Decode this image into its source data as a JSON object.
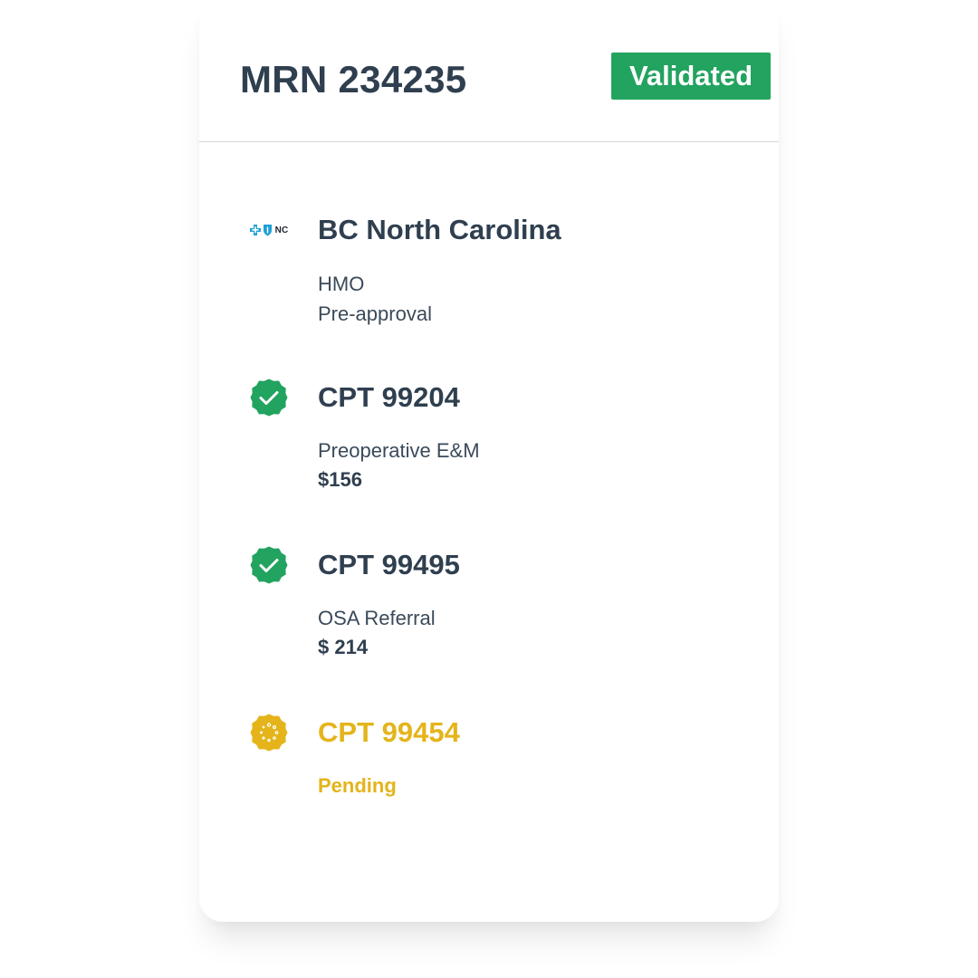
{
  "header": {
    "title": "MRN 234235",
    "status": "Validated"
  },
  "colors": {
    "validated": "#22a35f",
    "pending": "#e4b41a",
    "text": "#2f3f4f",
    "insurer_logo": "#1f9fd8"
  },
  "insurer": {
    "icon": "bcbs-logo-icon",
    "logo_text": "NC",
    "name": "BC North Carolina",
    "plan": "HMO",
    "requirement": "Pre-approval"
  },
  "procedures": [
    {
      "code": "CPT 99204",
      "status": "validated",
      "icon": "check-badge-icon",
      "description": "Preoperative E&M",
      "amount": "$156"
    },
    {
      "code": "CPT 99495",
      "status": "validated",
      "icon": "check-badge-icon",
      "description": "OSA Referral",
      "amount": "$ 214"
    },
    {
      "code": "CPT 99454",
      "status": "pending",
      "icon": "loading-badge-icon",
      "status_label": "Pending"
    }
  ]
}
